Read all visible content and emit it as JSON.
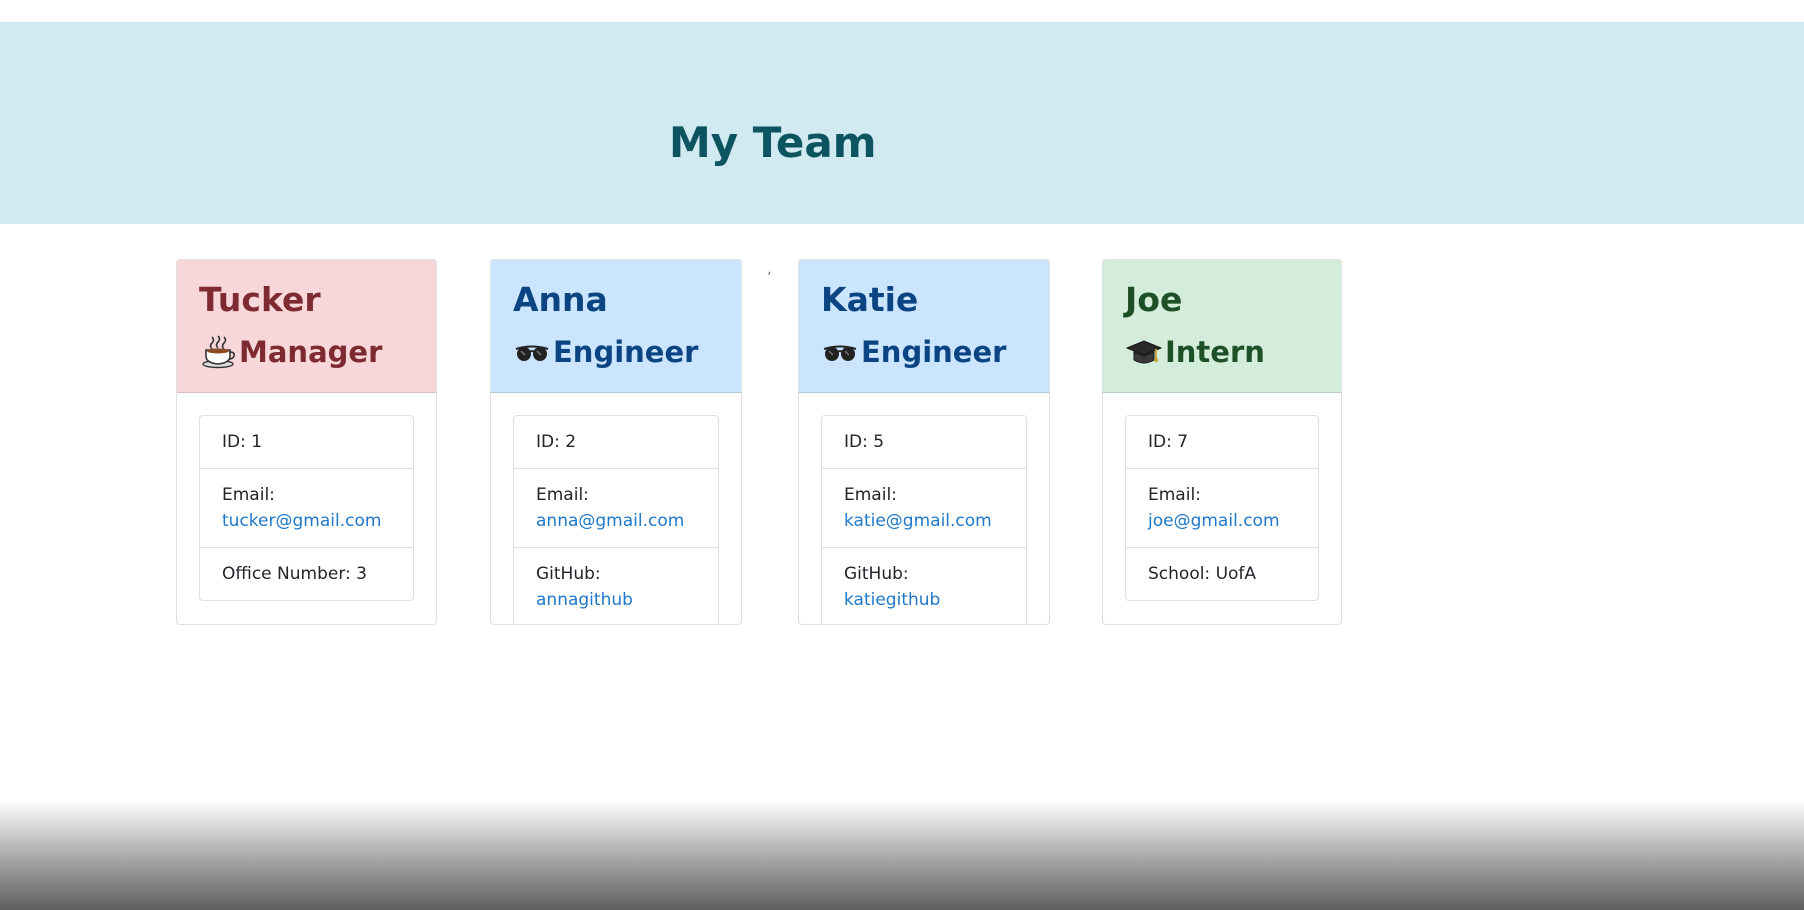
{
  "header": {
    "title": "My Team"
  },
  "stray_mark": "ʼ",
  "colors": {
    "manager_bg": "#f8d7da",
    "engineer_bg": "#cce5ff",
    "intern_bg": "#d4edda",
    "header_bg": "#d1e9f0",
    "link": "#1f78c9"
  },
  "cards": [
    {
      "name": "Tucker",
      "role": "Manager",
      "icon": "coffee-cup-icon",
      "id_text": "ID: 1",
      "email_label": "Email:",
      "email": "tucker@gmail.com",
      "extra_label": "Office Number: 3",
      "extra_link": ""
    },
    {
      "name": "Anna",
      "role": "Engineer",
      "icon": "glasses-icon",
      "id_text": "ID: 2",
      "email_label": "Email:",
      "email": "anna@gmail.com",
      "extra_label": "GitHub: ",
      "extra_link": "annagithub"
    },
    {
      "name": "Katie",
      "role": "Engineer",
      "icon": "glasses-icon",
      "id_text": "ID: 5",
      "email_label": "Email:",
      "email": "katie@gmail.com",
      "extra_label": "GitHub: ",
      "extra_link": "katiegithub"
    },
    {
      "name": "Joe",
      "role": "Intern",
      "icon": "graduation-cap-icon",
      "id_text": "ID: 7",
      "email_label": "Email:",
      "email": "joe@gmail.com",
      "extra_label": "School: UofA",
      "extra_link": ""
    }
  ]
}
